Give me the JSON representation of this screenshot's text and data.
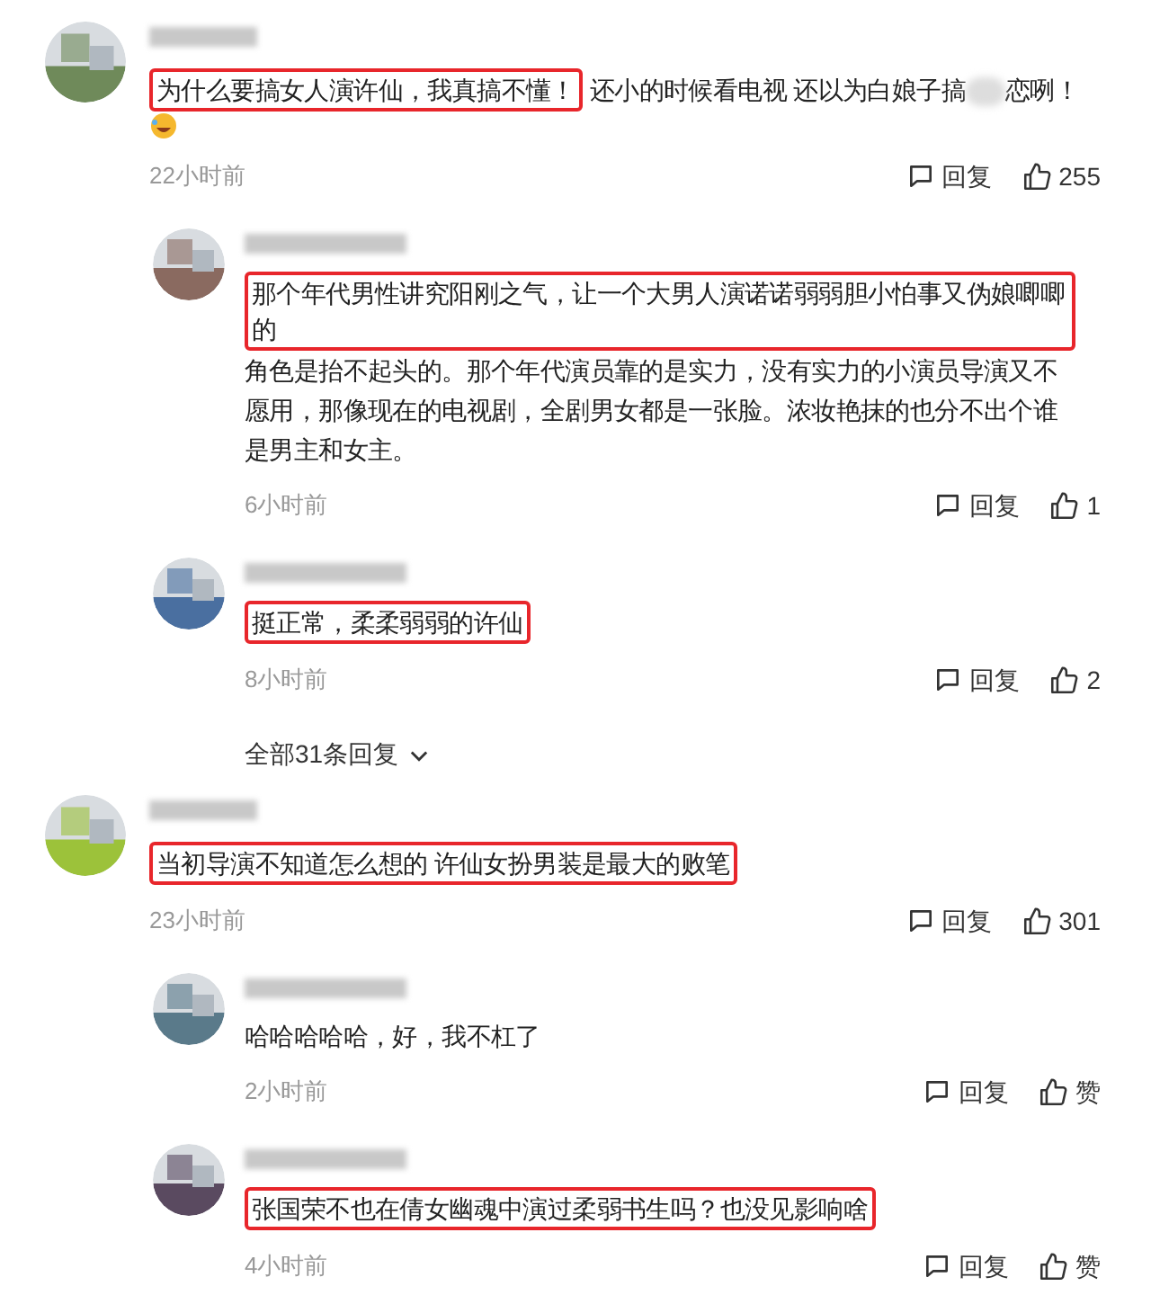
{
  "threads": [
    {
      "comment": {
        "highlight": "为什么要搞女人演许仙，我真搞不懂！",
        "text": "还小的时候看电视 还以为白娘子搞",
        "text_after_blur": "恋咧！",
        "emoji": true,
        "time": "22小时前",
        "reply_label": "回复",
        "like_label": "255"
      },
      "replies": [
        {
          "highlight": "那个年代男性讲究阳刚之气，让一个大男人演诺诺弱弱胆小怕事又伪娘唧唧的",
          "text": "角色是抬不起头的。那个年代演员靠的是实力，没有实力的小演员导演又不愿用，那像现在的电视剧，全剧男女都是一张脸。浓妆艳抹的也分不出个谁是男主和女主。",
          "time": "6小时前",
          "reply_label": "回复",
          "like_label": "1"
        },
        {
          "highlight": "挺正常，柔柔弱弱的许仙",
          "time": "8小时前",
          "reply_label": "回复",
          "like_label": "2"
        }
      ],
      "more_replies": "全部31条回复"
    },
    {
      "comment": {
        "highlight": "当初导演不知道怎么想的 许仙女扮男装是最大的败笔",
        "time": "23小时前",
        "reply_label": "回复",
        "like_label": "301"
      },
      "replies": [
        {
          "text": "哈哈哈哈哈，好，我不杠了",
          "time": "2小时前",
          "reply_label": "回复",
          "like_label": "赞"
        },
        {
          "highlight": "张国荣不也在倩女幽魂中演过柔弱书生吗？也没见影响啥",
          "time": "4小时前",
          "reply_label": "回复",
          "like_label": "赞"
        }
      ]
    }
  ]
}
